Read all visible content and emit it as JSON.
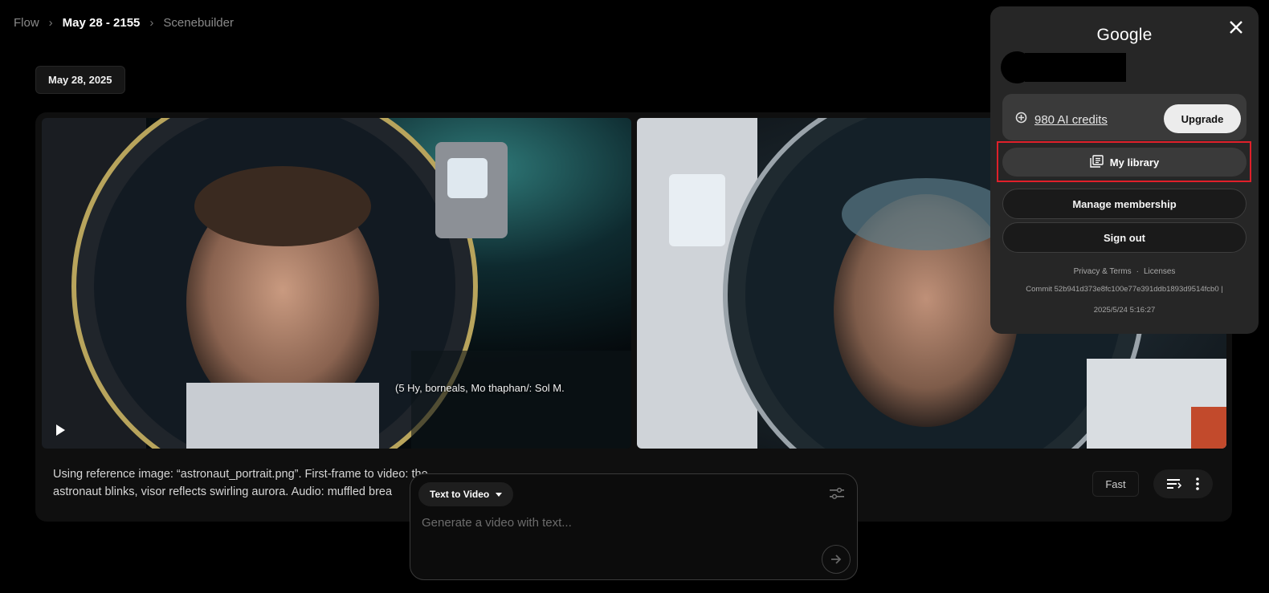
{
  "breadcrumb": {
    "root": "Flow",
    "current": "May 28 - 2155",
    "page": "Scenebuilder"
  },
  "date_chip": "May 28, 2025",
  "videos": [
    {
      "subtitle": "(5  Hy, borneals, Mo thaphan/: Sol M."
    },
    {
      "subtitle": ""
    }
  ],
  "prompt": "Using reference image: “astronaut_portrait.png”. First-frame to video: the astronaut blinks, visor reflects swirling aurora. Audio: muffled brea",
  "controls": {
    "speed_label": "Fast"
  },
  "composer": {
    "mode_label": "Text to Video",
    "placeholder": "Generate a video with text..."
  },
  "account": {
    "brand": "Google",
    "credits_label": "980 AI credits",
    "upgrade_label": "Upgrade",
    "library_label": "My library",
    "membership_label": "Manage membership",
    "signout_label": "Sign out",
    "privacy_label": "Privacy & Terms",
    "licenses_label": "Licenses",
    "commit": "Commit 52b941d373e8fc100e77e391ddb1893d9514fcb0 |",
    "build_date": "2025/5/24 5:16:27"
  },
  "colors": {
    "highlight": "#e0202a",
    "panel": "#262626",
    "background": "#000000"
  }
}
